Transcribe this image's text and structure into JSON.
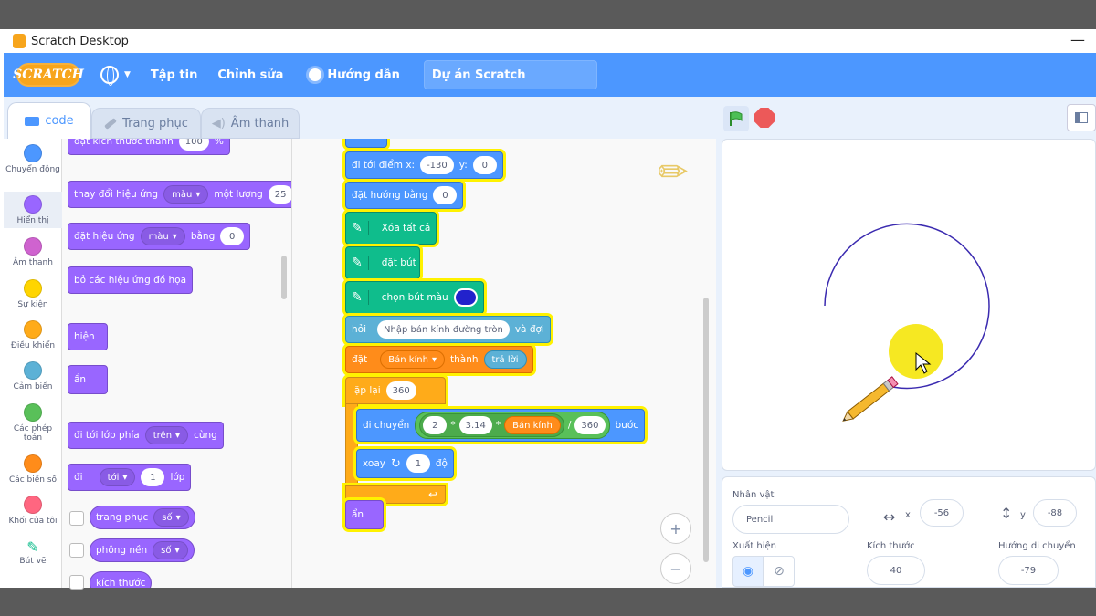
{
  "window": {
    "title": "Scratch Desktop",
    "minimize": "—"
  },
  "menubar": {
    "logo": "SCRATCH",
    "file": "Tập tin",
    "edit": "Chỉnh sửa",
    "tutorials": "Hướng dẫn",
    "project_title": "Dự án Scratch"
  },
  "tabs": {
    "code": "code",
    "costumes": "Trang phục",
    "sounds": "Âm thanh"
  },
  "categories": [
    {
      "label": "Chuyển động",
      "color": "#4c97ff"
    },
    {
      "label": "Hiển thị",
      "color": "#9966ff"
    },
    {
      "label": "Âm thanh",
      "color": "#cf63cf"
    },
    {
      "label": "Sự kiện",
      "color": "#ffd500"
    },
    {
      "label": "Điều khiển",
      "color": "#ffab19"
    },
    {
      "label": "Cảm biến",
      "color": "#5cb1d6"
    },
    {
      "label": "Các phép toán",
      "color": "#59c059"
    },
    {
      "label": "Các biến số",
      "color": "#ff8c1a"
    },
    {
      "label": "Khối của tôi",
      "color": "#ff6680"
    },
    {
      "label": "Bút vẽ",
      "color": "#0fbd8c"
    }
  ],
  "palette": {
    "set_size_text": "đặt kích thước thành",
    "set_size_val": "100",
    "set_size_unit": "%",
    "change_effect": "thay đổi hiệu ứng",
    "change_effect_dd": "màu",
    "change_effect_by": "một lượng",
    "change_effect_val": "25",
    "set_effect": "đặt hiệu ứng",
    "set_effect_dd": "màu",
    "set_effect_to": "bằng",
    "set_effect_val": "0",
    "clear_effects": "bỏ các hiệu ứng đồ họa",
    "show": "hiện",
    "hide": "ẩn",
    "go_layer": "đi tới lớp phía",
    "go_layer_dd": "trên",
    "go_layer_end": "cùng",
    "go_layers": "đi",
    "go_layers_dd": "tới",
    "go_layers_val": "1",
    "go_layers_end": "lớp",
    "costume_rep": "trang phục",
    "costume_rep_dd": "số",
    "backdrop_rep": "phông nền",
    "backdrop_rep_dd": "số",
    "size_rep": "kích thước"
  },
  "script": {
    "goto": "đi tới điểm x:",
    "goto_x": "-130",
    "goto_y_label": "y:",
    "goto_y": "0",
    "point": "đặt hướng bằng",
    "point_val": "0",
    "clear": "Xóa tất cả",
    "pen_down": "đặt bút",
    "pen_color": "chọn bút màu",
    "pen_color_value": "#2222cc",
    "ask": "hỏi",
    "ask_text": "Nhập bán kính đường tròn",
    "ask_wait": "và đợi",
    "set": "đặt",
    "set_var": "Bán kính",
    "set_to": "thành",
    "answer": "trả lời",
    "repeat": "lặp lại",
    "repeat_val": "360",
    "move": "di chuyển",
    "op_2": "2",
    "op_times": "*",
    "op_314": "3.14",
    "op_times2": "*",
    "op_radius": "Bán kính",
    "op_div": "/",
    "op_360": "360",
    "move_steps": "bước",
    "turn": "xoay",
    "turn_val": "1",
    "turn_unit": "độ",
    "hide": "ẩn"
  },
  "zoom": {
    "in": "+",
    "out": "−"
  },
  "sprite": {
    "sprite_label": "Nhân vật",
    "sprite_name": "Pencil",
    "x_label": "x",
    "x_val": "-56",
    "y_label": "y",
    "y_val": "-88",
    "show_label": "Xuất hiện",
    "size_label": "Kích thước",
    "size_val": "40",
    "direction_label": "Hướng di chuyển",
    "direction_val": "-79"
  }
}
